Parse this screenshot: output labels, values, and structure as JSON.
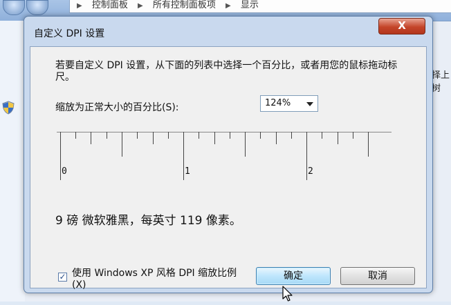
{
  "background": {
    "breadcrumbs": [
      "控制面板",
      "所有控制面板项",
      "显示"
    ],
    "right_text": "择上树"
  },
  "dialog": {
    "title": "自定义 DPI 设置",
    "close_label": "X",
    "instructions": "若要自定义 DPI 设置，从下面的列表中选择一个百分比，或者用您的鼠标拖动标尺。",
    "scale_label": "缩放为正常大小的百分比(S):",
    "scale_value": "124%",
    "ruler_labels": [
      "0",
      "1",
      "2"
    ],
    "sample_text": "9 磅 微软雅黑，每英寸 119 像素。",
    "xp_style_checked": true,
    "xp_style_label": "使用 Windows XP 风格 DPI 缩放比例(X)",
    "ok_label": "确定",
    "cancel_label": "取消"
  },
  "icons": [
    "shield-icon",
    "close-icon",
    "chevron-down-icon",
    "cursor-icon",
    "checkmark-icon"
  ]
}
